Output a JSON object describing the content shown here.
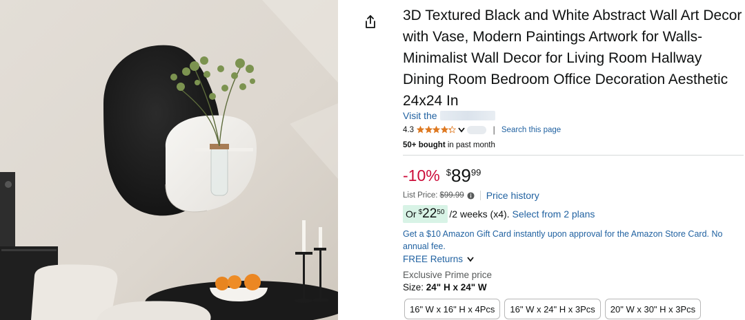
{
  "product": {
    "title": "3D Textured Black and White Abstract Wall Art Decor with Vase, Modern Paintings Artwork for Walls-Minimalist Wall Decor for Living Room Hallway Dining Room Bedroom Office Decoration Aesthetic 24x24 In",
    "store_prefix": "Visit the",
    "rating": "4.3",
    "rating_fraction": 0.86,
    "search_page": "Search this page",
    "bought_bold": "50+ bought",
    "bought_rest": "in past month"
  },
  "price": {
    "discount": "-10%",
    "currency": "$",
    "whole": "89",
    "fraction": "99",
    "list_label": "List Price:",
    "list_value": "$99.99",
    "price_history": "Price history"
  },
  "installment": {
    "or_label": "Or",
    "currency": "$",
    "whole": "22",
    "fraction": "50",
    "term": "/2 weeks (x4).",
    "plans_link": "Select from 2 plans"
  },
  "gift_card": "Get a $10 Amazon Gift Card instantly upon approval for the Amazon Store Card. No annual fee.",
  "returns": "FREE Returns",
  "prime": "Exclusive Prime price",
  "size": {
    "label": "Size:",
    "value": "24\" H x 24\" W",
    "options": [
      "16\" W x 16\" H x 4Pcs",
      "16\" W x 24\" H x 3Pcs",
      "20\" W x 30\" H x 3Pcs"
    ]
  },
  "colors": {
    "link": "#2162a1",
    "discount": "#cc0c39",
    "star": "#de7921",
    "badge": "#d8f3e6"
  },
  "icons": [
    "share-icon",
    "star-icon",
    "chevron-down-icon",
    "info-icon"
  ]
}
